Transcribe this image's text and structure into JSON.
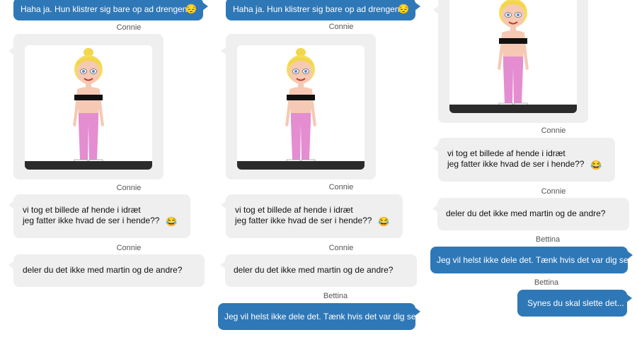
{
  "contacts": {
    "connie": "Connie",
    "bettina": "Bettina"
  },
  "messages": {
    "haha": "Haha ja. Hun klistrer sig bare op ad drengene",
    "tog_line1": "vi tog et billede af hende i idræt",
    "tog_line2": "jeg fatter ikke hvad de ser i hende??",
    "deler": "deler du det ikke med martin og de andre?",
    "helst": "Jeg vil helst ikke dele det. Tænk hvis det var dig selv",
    "slette": "Synes du skal slette det..."
  },
  "emoji": {
    "sad": "😔",
    "laugh": "😂"
  },
  "colors": {
    "outgoing": "#2f78b7",
    "incoming": "#efefef",
    "photo_floor": "#2b2b2b"
  }
}
